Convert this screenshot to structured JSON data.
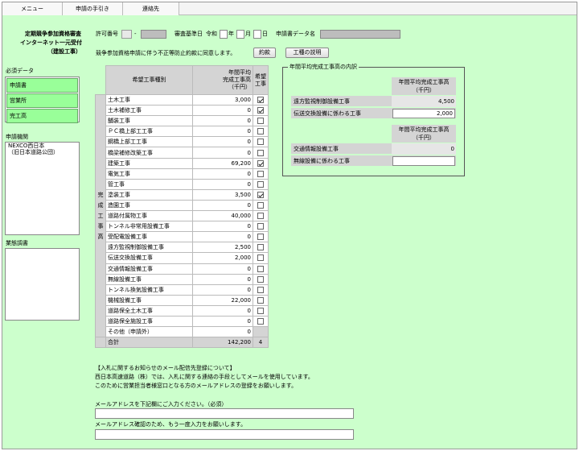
{
  "tabs": [
    "メニュー",
    "申請の手引き",
    "連絡先"
  ],
  "header": {
    "title_lines": [
      "定期競争参加資格審査",
      "インターネット一元受付",
      "（建設工事）"
    ],
    "permit_label": "許可番号",
    "permit_select": "",
    "permit_dash": "-",
    "base_date_label": "審査基準日",
    "era": "令和",
    "year_unit": "年",
    "month_unit": "月",
    "day_unit": "日",
    "data_name_label": "申請書データ名",
    "consent_text": "競争参加資格申請に伴う不正等防止約款に同意します。",
    "btn_agreement": "約款",
    "btn_work_explain": "工種の説明"
  },
  "sidebar": {
    "required_label": "必須データ",
    "required_items": [
      "申請書",
      "営業所",
      "完工高"
    ],
    "agency_label": "申請機関",
    "agency_options": [
      "NEXCO西日本",
      "（旧日本道路公団）"
    ],
    "business_label": "業態調書"
  },
  "work_table": {
    "col_type": "希望工事種別",
    "col_avg_lines": [
      "年間平均",
      "完成工事高",
      "（千円）"
    ],
    "col_hope_lines": [
      "希望",
      "工事"
    ],
    "side_label_chars": [
      "完",
      "成",
      "工",
      "事",
      "高"
    ],
    "rows": [
      {
        "name": "土木工事",
        "value": "3,000",
        "checked": true
      },
      {
        "name": "土木補修工事",
        "value": "0",
        "checked": true
      },
      {
        "name": "舗装工事",
        "value": "0",
        "checked": false
      },
      {
        "name": "ＰＣ橋上部工工事",
        "value": "0",
        "checked": false
      },
      {
        "name": "鋼橋上部工工事",
        "value": "0",
        "checked": false
      },
      {
        "name": "橋梁補修改築工事",
        "value": "0",
        "checked": false
      },
      {
        "name": "建築工事",
        "value": "69,200",
        "checked": true
      },
      {
        "name": "電気工事",
        "value": "0",
        "checked": false
      },
      {
        "name": "管工事",
        "value": "0",
        "checked": false
      },
      {
        "name": "塗装工事",
        "value": "3,500",
        "checked": true
      },
      {
        "name": "造園工事",
        "value": "0",
        "checked": false
      },
      {
        "name": "道路付属物工事",
        "value": "40,000",
        "checked": false
      },
      {
        "name": "トンネル非常用設備工事",
        "value": "0",
        "checked": false
      },
      {
        "name": "受配電設備工事",
        "value": "0",
        "checked": false
      },
      {
        "name": "遠方監視制御設備工事",
        "value": "2,500",
        "checked": false
      },
      {
        "name": "伝送交換設備工事",
        "value": "2,000",
        "checked": false
      },
      {
        "name": "交通情報設備工事",
        "value": "0",
        "checked": false
      },
      {
        "name": "無線設備工事",
        "value": "0",
        "checked": false
      },
      {
        "name": "トンネル換気設備工事",
        "value": "0",
        "checked": false
      },
      {
        "name": "機械設備工事",
        "value": "22,000",
        "checked": false
      },
      {
        "name": "道路保全土木工事",
        "value": "0",
        "checked": false
      },
      {
        "name": "道路保全施設工事",
        "value": "0",
        "checked": false
      }
    ],
    "other_label": "その他（申請外）",
    "other_value": "0",
    "total_label": "合計",
    "total_value": "142,200",
    "total_count": "4"
  },
  "breakdown": {
    "title": "年間平均完成工事高の内訳",
    "hdr1_lines": [
      "年間平均完成工事高",
      "（千円）"
    ],
    "rows1": [
      {
        "name": "遠方監視制御設備工事",
        "value": "4,500",
        "editable": false
      },
      {
        "name": "伝送交換設備に係わる工事",
        "value": "2,000",
        "editable": true
      }
    ],
    "hdr2_lines": [
      "年間平均完成工事高",
      "（千円）"
    ],
    "rows2": [
      {
        "name": "交通情報設備工事",
        "value": "0",
        "editable": false
      },
      {
        "name": "無線設備に係わる工事",
        "value": "",
        "editable": true
      }
    ]
  },
  "mail": {
    "heading": "【入札に関するお知らせのメール配信先登録について】",
    "line1": "西日本高速道路（株）では、入札に関する連絡の手段としてメールを使用しています。",
    "line2": "このために営業担当者様窓口となる方のメールアドレスの登録をお願いします。",
    "label1": "メールアドレスを下記欄にご入力ください。（必須）",
    "label2": "メールアドレス確認のため、もう一度入力をお願いします。",
    "value1": "",
    "value2": ""
  }
}
